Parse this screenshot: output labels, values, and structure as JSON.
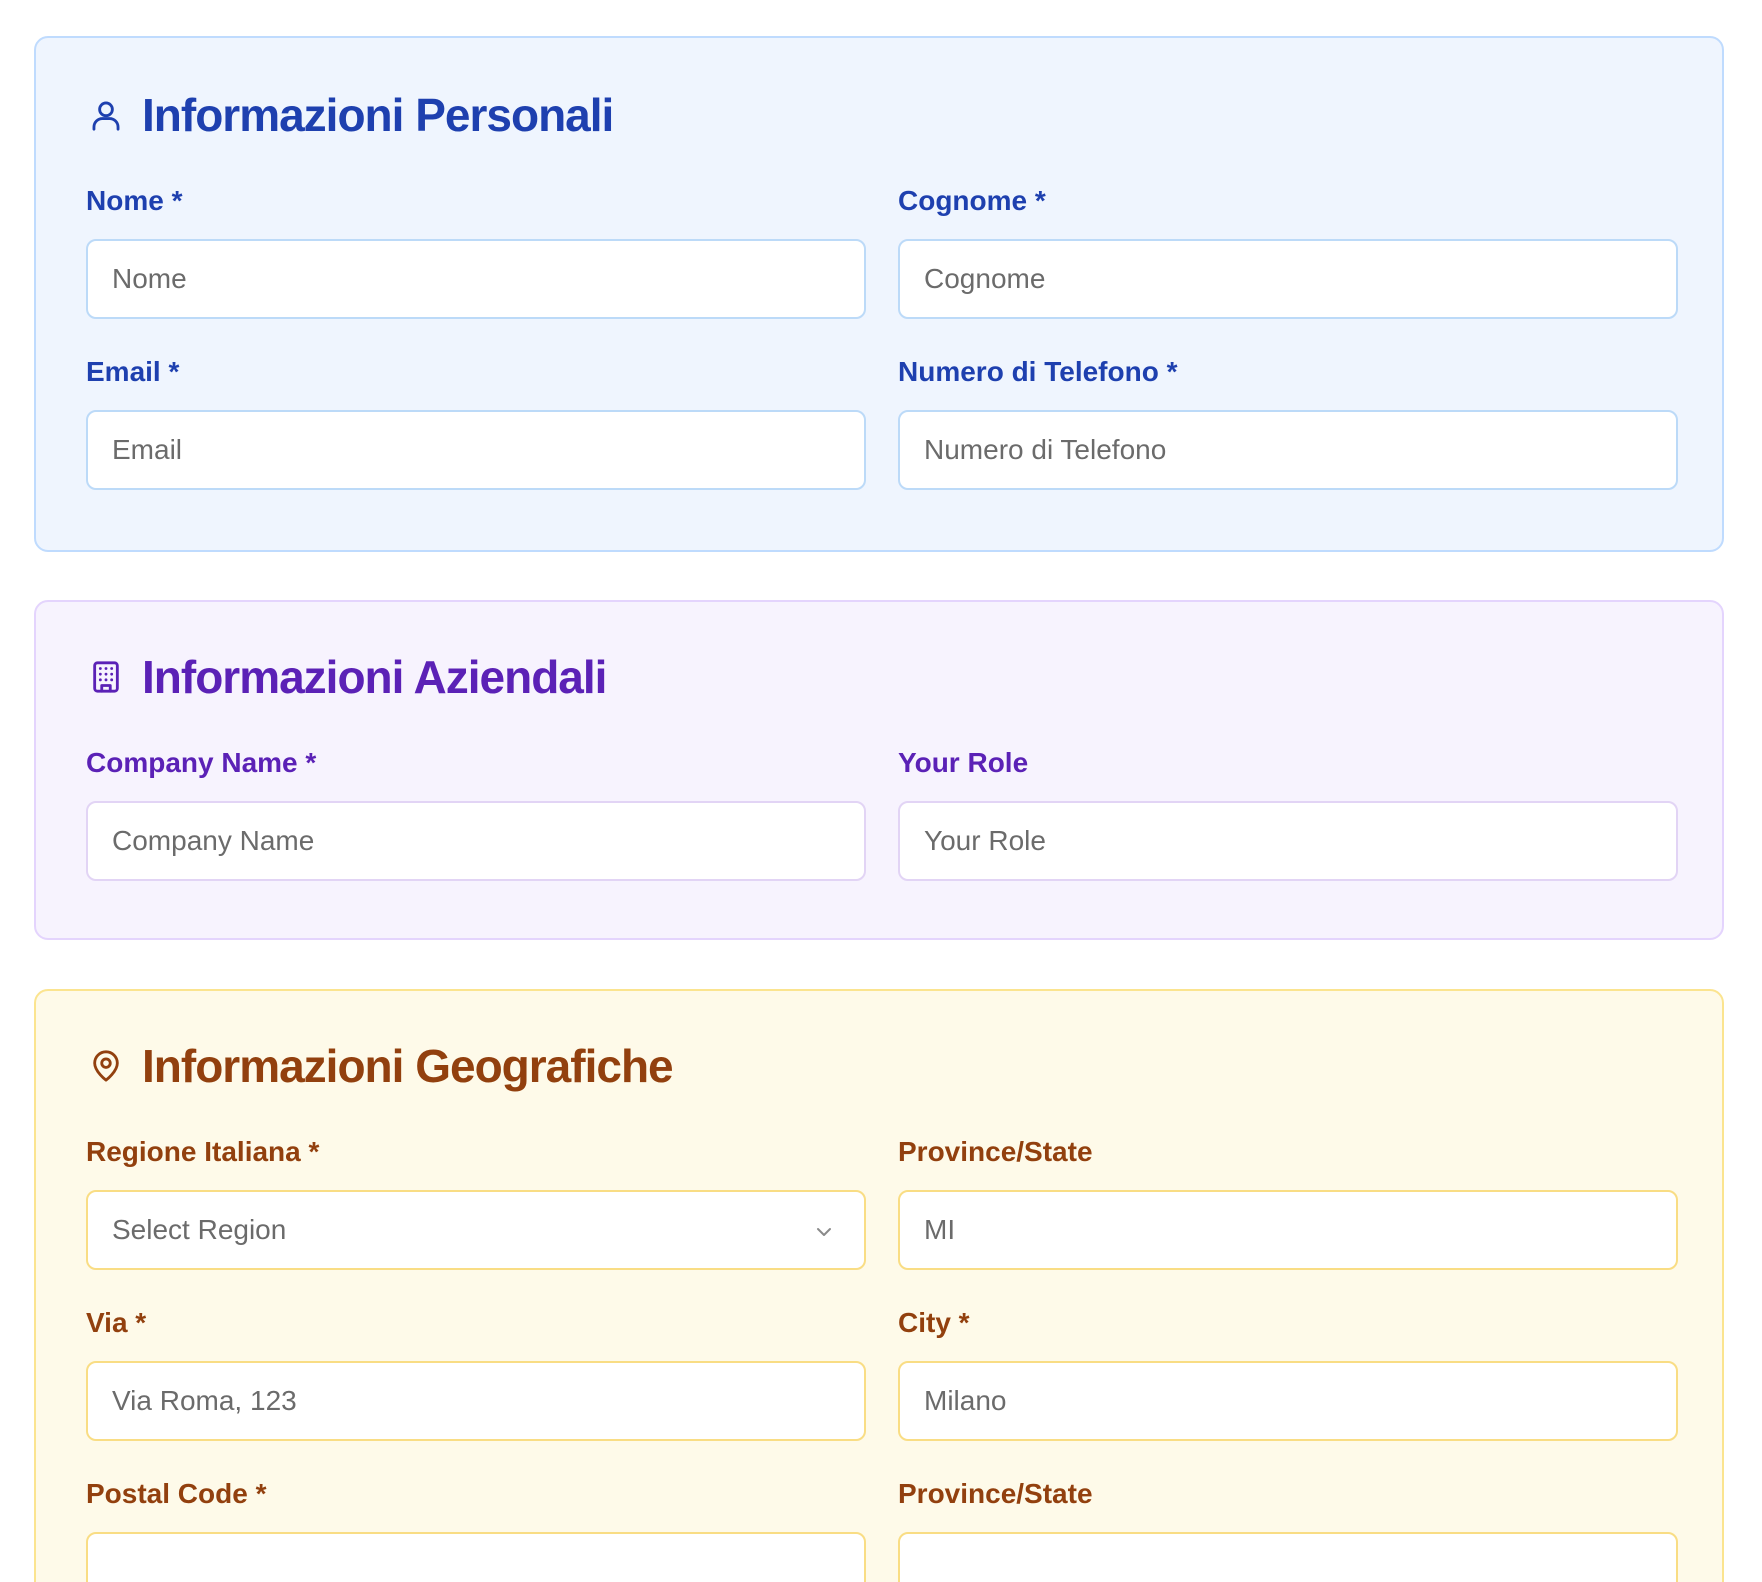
{
  "personal": {
    "title": "Informazioni Personali",
    "icon": "user-icon",
    "accent": "#1e40af",
    "fields": [
      {
        "label": "Nome *",
        "placeholder": "Nome"
      },
      {
        "label": "Cognome *",
        "placeholder": "Cognome"
      },
      {
        "label": "Email *",
        "placeholder": "Email"
      },
      {
        "label": "Numero di Telefono *",
        "placeholder": "Numero di Telefono"
      }
    ]
  },
  "company": {
    "title": "Informazioni Aziendali",
    "icon": "building-icon",
    "accent": "#5b21b6",
    "fields": [
      {
        "label": "Company Name *",
        "placeholder": "Company Name"
      },
      {
        "label": "Your Role",
        "placeholder": "Your Role"
      }
    ]
  },
  "geo": {
    "title": "Informazioni Geografiche",
    "icon": "map-pin-icon",
    "accent": "#92400e",
    "region": {
      "label": "Regione Italiana *",
      "selected": "Select Region"
    },
    "province": {
      "label": "Province/State",
      "placeholder": "MI"
    },
    "via": {
      "label": "Via *",
      "placeholder": "Via Roma, 123"
    },
    "city": {
      "label": "City *",
      "placeholder": "Milano"
    },
    "postal": {
      "label": "Postal Code *",
      "placeholder": ""
    },
    "province2": {
      "label": "Province/State",
      "placeholder": ""
    }
  }
}
